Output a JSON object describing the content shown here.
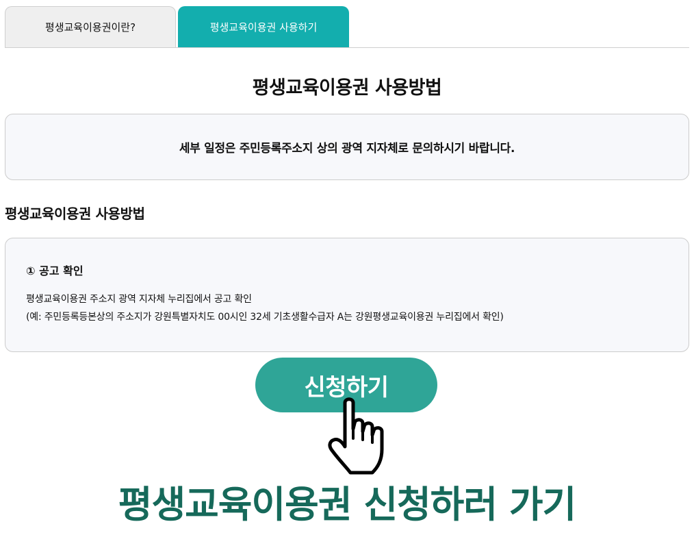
{
  "tabs": [
    {
      "label": "평생교육이용권이란?",
      "active": false
    },
    {
      "label": "평생교육이용권 사용하기",
      "active": true
    }
  ],
  "page_title": "평생교육이용권 사용방법",
  "notice": {
    "text": "세부 일정은 주민등록주소지 상의 광역 지자체로 문의하시기 바랍니다."
  },
  "section_title": "평생교육이용권 사용방법",
  "step": {
    "title": "① 공고 확인",
    "line1": "평생교육이용권 주소지 광역 지자체 누리집에서 공고 확인",
    "line2": "(예: 주민등록등본상의 주소지가 강원특별자치도 00시인 32세 기초생활수급자 A는 강원평생교육이용권 누리집에서 확인)"
  },
  "apply_button_label": "신청하기",
  "hand_icon": "pointing-hand-icon",
  "banner_text": "평생교육이용권 신청하러 가기",
  "colors": {
    "tab_active": "#13aeae",
    "button": "#2fa597",
    "banner": "#16695a"
  }
}
